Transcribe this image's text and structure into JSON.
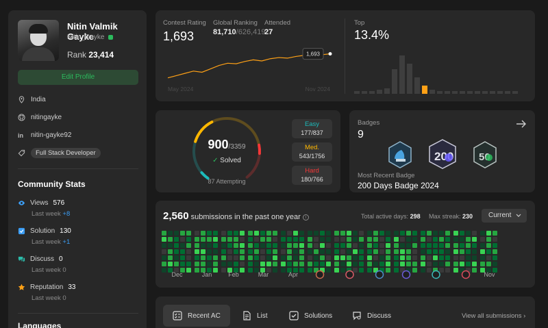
{
  "profile": {
    "name": "Nitin Valmik Gayke",
    "username": "Nitin_Gayke",
    "rank_label": "Rank",
    "rank_value": "23,414",
    "edit_button": "Edit Profile",
    "location": "India",
    "github": "nitingayke",
    "linkedin": "nitin-gayke92",
    "skill_tag": "Full Stack Developer"
  },
  "community": {
    "title": "Community Stats",
    "items": [
      {
        "label": "Views",
        "value": "576",
        "sub": "Last week",
        "delta": "+8",
        "icon": "eye-icon"
      },
      {
        "label": "Solution",
        "value": "130",
        "sub": "Last week",
        "delta": "+1",
        "icon": "check-square-icon"
      },
      {
        "label": "Discuss",
        "value": "0",
        "sub": "Last week",
        "delta": "0",
        "icon": "chat-icon"
      },
      {
        "label": "Reputation",
        "value": "33",
        "sub": "Last week",
        "delta": "0",
        "icon": "star-icon"
      }
    ],
    "languages_title": "Languages"
  },
  "contest": {
    "rating_label": "Contest Rating",
    "rating_value": "1,693",
    "global_label": "Global Ranking",
    "global_value": "81,710",
    "global_total": "/626,419",
    "attended_label": "Attended",
    "attended_value": "27",
    "tooltip": "1,693",
    "start_label": "May 2024",
    "end_label": "Nov 2024",
    "top_label": "Top",
    "top_value": "13.4%",
    "trend": [
      1480,
      1500,
      1520,
      1540,
      1530,
      1560,
      1590,
      1610,
      1605,
      1625,
      1640,
      1630,
      1650,
      1660,
      1655,
      1670,
      1680,
      1675,
      1685,
      1693
    ],
    "distribution": [
      2,
      2,
      2,
      3,
      4,
      18,
      28,
      22,
      12,
      6,
      3,
      2,
      2,
      2,
      2,
      2,
      2,
      2,
      2,
      2,
      2,
      2
    ],
    "highlight_index": 9,
    "accent": "#ffa116"
  },
  "solved": {
    "solved_count": "900",
    "total": "/3359",
    "solved_label": "Solved",
    "attempting": "87 Attempting",
    "easy": {
      "label": "Easy",
      "count": "177/837",
      "color": "#1cbaba",
      "done": 177,
      "total": 837
    },
    "medium": {
      "label": "Med.",
      "count": "543/1756",
      "color": "#ffb700",
      "done": 543,
      "total": 1756
    },
    "hard": {
      "label": "Hard",
      "count": "180/766",
      "color": "#f63737",
      "done": 180,
      "total": 766
    }
  },
  "badges": {
    "title": "Badges",
    "count": "9",
    "recent_label": "Most Recent Badge",
    "recent_value": "200 Days Badge 2024"
  },
  "submissions": {
    "count": "2,560",
    "label": "submissions in the past one year",
    "active_label": "Total active days:",
    "active_value": "298",
    "streak_label": "Max streak:",
    "streak_value": "230",
    "select_value": "Current",
    "months": [
      "Dec",
      "Jan",
      "Feb",
      "Mar",
      "Apr",
      "",
      "",
      "",
      "",
      "",
      "",
      "Nov"
    ],
    "level_colors": [
      "#393939",
      "#0e4429",
      "#006d32",
      "#26a641",
      "#39d353"
    ]
  },
  "tabs": {
    "items": [
      {
        "label": "Recent AC",
        "icon": "list-check-icon"
      },
      {
        "label": "List",
        "icon": "document-icon"
      },
      {
        "label": "Solutions",
        "icon": "check-box-icon"
      },
      {
        "label": "Discuss",
        "icon": "chat-search-icon"
      }
    ],
    "view_all": "View all submissions"
  }
}
